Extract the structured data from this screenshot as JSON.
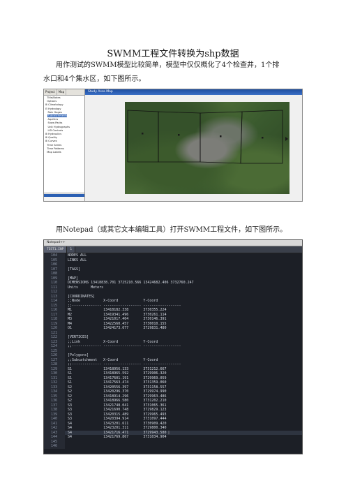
{
  "title": "SWMM工程文件转换为shp数据",
  "para1_line1": "用作测试的SWMM模型比较简单，模型中仅仅概化了4个检查井，1个排",
  "para1_line2": "水口和4个集水区，如下图所示。",
  "para2": "用Notepad（或其它文本编辑工具）打开SWMM工程文件，如下图所示。",
  "screenshot1": {
    "tabs": [
      "Project",
      "Map"
    ],
    "map_title": "Study Area Map",
    "tree": [
      "Title/Notes",
      "Options",
      "Climatology",
      "Hydrology",
      "Rain Gages",
      "Subcatchments",
      "Aquifers",
      "Snow Packs",
      "Unit Hydrographs",
      "LID Controls",
      "Hydraulics",
      "Quality",
      "Curves",
      "Time Series",
      "Time Patterns",
      "Map Labels"
    ]
  },
  "screenshot2": {
    "menu": "Notepad++",
    "tabs": [
      "TEST1.INP",
      "1"
    ],
    "first_line_number": 104,
    "lines": [
      "NODES ALL",
      "LINKS ALL",
      "",
      "[TAGS]",
      "",
      "[MAP]",
      "DIMENSIONS 13418838.701 3725210.566 13424682.406 3732760.247",
      "Units      Meters",
      "",
      "[COORDINATES]",
      ";;Node           X-Coord            Y-Coord",
      ";;-------------- ------------------ ------------------",
      "M1               13418182.338       3730355.224",
      "M2               13419341.496       3730261.114",
      "M3               13421017.404       3730146.391",
      "M4               13422560.457       3730010.155",
      "O1               13424173.677       3729831.480",
      "",
      "[VERTICES]",
      ";;Link           X-Coord            Y-Coord",
      ";;-------------- ------------------ ------------------",
      "",
      "[Polygons]",
      ";;Subcatchment   X-Coord            Y-Coord",
      ";;-------------- ------------------ ------------------",
      "S1               13418956.133       3731212.667",
      "S1               13418965.592       3729906.320",
      "S1               13417601.191       3729969.059",
      "S1               13417563.474       3731359.060",
      "S2               13420556.397       3731158.557",
      "S2               13420296.370       3729974.990",
      "S2               13418914.296       3729963.486",
      "S2               13418966.580       3731202.210",
      "S3               13421748.041       3731065.361",
      "S3               13421690.748       3729829.123",
      "S3               13420315.489       3729965.493",
      "S3               13420394.914       3731097.444",
      "S4               13423201.611       3730909.420",
      "S4               13423201.311       3729800.340",
      "S4               13421716.471       3729943.580",
      "S4               13421769.867       3731034.904",
      "",
      ""
    ],
    "cursor_line_index": 39
  }
}
